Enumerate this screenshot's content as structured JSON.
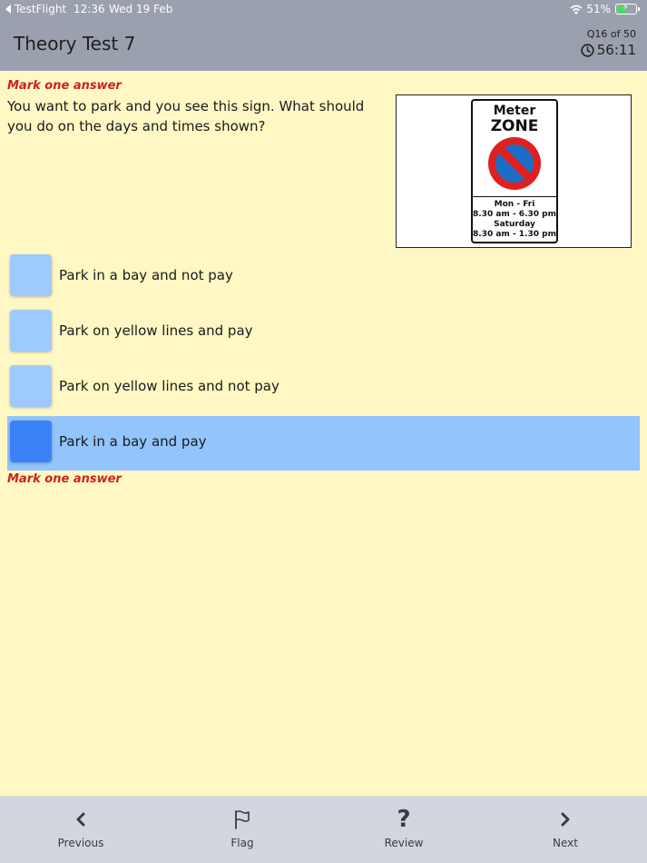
{
  "status_bar": {
    "back_app": "TestFlight",
    "time": "12:36",
    "date": "Wed 19 Feb",
    "battery": "51%"
  },
  "header": {
    "title": "Theory Test 7",
    "question_count": "Q16 of 50",
    "timer": "56:11"
  },
  "question": {
    "mark_label_top": "Mark one answer",
    "text": "You want to park and you see this sign. What should you do on the days and times shown?",
    "mark_label_bottom": "Mark one answer",
    "sign": {
      "line1": "Meter",
      "line2": "ZONE",
      "times": [
        "Mon - Fri",
        "8.30 am - 6.30 pm",
        "Saturday",
        "8.30 am - 1.30 pm"
      ]
    }
  },
  "answers": [
    {
      "text": "Park in a bay and not pay",
      "selected": false
    },
    {
      "text": "Park on yellow lines and pay",
      "selected": false
    },
    {
      "text": "Park on yellow lines and not pay",
      "selected": false
    },
    {
      "text": "Park in a bay and pay",
      "selected": true
    }
  ],
  "toolbar": {
    "previous": "Previous",
    "flag": "Flag",
    "review": "Review",
    "next": "Next"
  },
  "colors": {
    "background": "#fff8c4",
    "header": "#9aa0ad",
    "selected_row": "#93c4fc",
    "checkbox": "#9fcaff",
    "checkbox_selected": "#3b82f6",
    "mark_label": "#cc2222",
    "toolbar": "#d4d6dd"
  }
}
